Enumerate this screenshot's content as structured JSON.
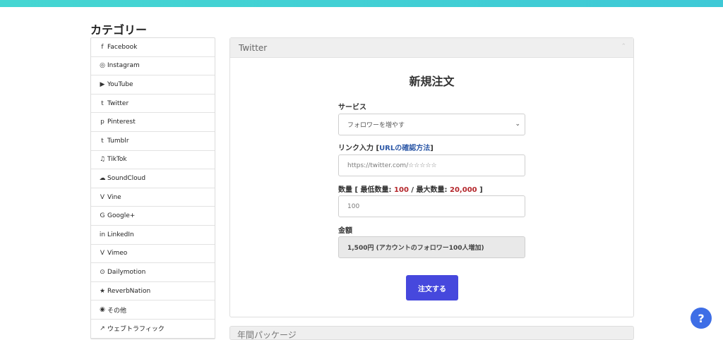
{
  "categories": {
    "title": "カテゴリー",
    "items": [
      {
        "icon": "facebook-icon",
        "glyph": "f",
        "label": "Facebook"
      },
      {
        "icon": "instagram-icon",
        "glyph": "◎",
        "label": "Instagram"
      },
      {
        "icon": "youtube-icon",
        "glyph": "▶",
        "label": "YouTube"
      },
      {
        "icon": "twitter-icon",
        "glyph": "t",
        "label": "Twitter"
      },
      {
        "icon": "pinterest-icon",
        "glyph": "p",
        "label": "Pinterest"
      },
      {
        "icon": "tumblr-icon",
        "glyph": "t",
        "label": "Tumblr"
      },
      {
        "icon": "tiktok-icon",
        "glyph": "♫",
        "label": "TikTok"
      },
      {
        "icon": "soundcloud-icon",
        "glyph": "☁",
        "label": "SoundCloud"
      },
      {
        "icon": "vine-icon",
        "glyph": "V",
        "label": "Vine"
      },
      {
        "icon": "googleplus-icon",
        "glyph": "G",
        "label": "Google+"
      },
      {
        "icon": "linkedin-icon",
        "glyph": "in",
        "label": "LinkedIn"
      },
      {
        "icon": "vimeo-icon",
        "glyph": "V",
        "label": "Vimeo"
      },
      {
        "icon": "dailymotion-icon",
        "glyph": "⊙",
        "label": "Dailymotion"
      },
      {
        "icon": "star-icon",
        "glyph": "★",
        "label": "ReverbNation"
      },
      {
        "icon": "other-icon",
        "glyph": "◉",
        "label": "その他"
      },
      {
        "icon": "chart-icon",
        "glyph": "↗",
        "label": "ウェブトラフィック"
      }
    ]
  },
  "panel": {
    "header": "Twitter",
    "form_title": "新規注文",
    "service": {
      "label": "サービス",
      "value": "フォロワーを増やす"
    },
    "link": {
      "label": "リンク入力",
      "help_prefix": " [",
      "help_link": "URLの確認方法",
      "help_suffix": "]",
      "placeholder": "https://twitter.com/☆☆☆☆☆"
    },
    "quantity": {
      "label": "数量",
      "open": " [ ",
      "min_label": "最低数量: ",
      "min_value": "100",
      "sep": " / ",
      "max_label": "最大数量: ",
      "max_value": "20,000",
      "close": " ]",
      "placeholder": "100"
    },
    "price": {
      "label": "金額",
      "value": "1,500円 (アカウントのフォロワー100人増加)"
    },
    "submit": "注文する"
  },
  "next_panel": {
    "header": "年間パッケージ"
  },
  "help": {
    "label": "?"
  },
  "colors": {
    "accent": "#4648dd",
    "topbar": "#45d6d2",
    "help": "#3e6ee6",
    "link": "#2f5aa8",
    "highlight": "#b4262b"
  }
}
